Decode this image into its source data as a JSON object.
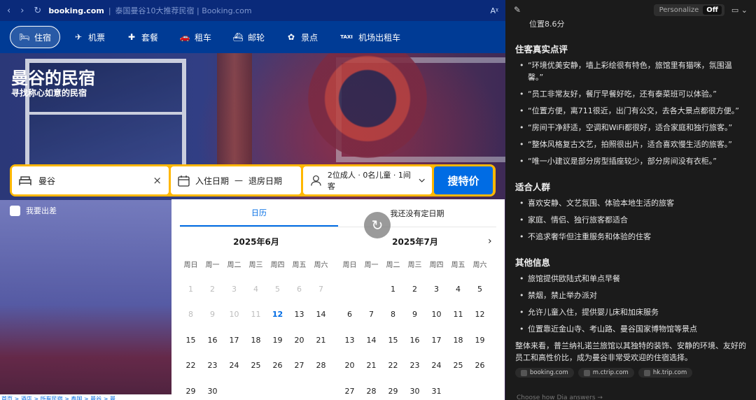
{
  "browser": {
    "domain": "booking.com",
    "separator": "|",
    "page_title": "泰国曼谷10大推荐民宿 | Booking.com",
    "nav_back": "‹",
    "nav_forward": "›",
    "reload": "↻",
    "translate": "Aᵡ"
  },
  "booking": {
    "tabs": [
      {
        "label": "住宿",
        "icon": "bed-icon",
        "glyph": "🛏"
      },
      {
        "label": "机票",
        "icon": "plane-icon",
        "glyph": "✈"
      },
      {
        "label": "套餐",
        "icon": "package-icon",
        "glyph": "✚"
      },
      {
        "label": "租车",
        "icon": "car-icon",
        "glyph": "🚗"
      },
      {
        "label": "邮轮",
        "icon": "ship-icon",
        "glyph": "⛴"
      },
      {
        "label": "景点",
        "icon": "attraction-icon",
        "glyph": "✿"
      },
      {
        "label": "机场出租车",
        "icon": "taxi-icon",
        "glyph": "TAXI"
      }
    ],
    "hero": {
      "title": "曼谷的民宿",
      "subtitle": "寻找称心如意的民宿"
    },
    "search": {
      "destination": "曼谷",
      "clear": "×",
      "checkin": "入住日期",
      "dash": "—",
      "checkout": "退房日期",
      "guests": "2位成人 · 0名儿童 · 1间客",
      "button": "搜特价"
    },
    "business_trip": "我要出差",
    "calendar": {
      "tab_calendar": "日历",
      "tab_flexible": "我还没有定日期",
      "weekdays": [
        "周日",
        "周一",
        "周二",
        "周三",
        "周四",
        "周五",
        "周六"
      ],
      "months": [
        {
          "title": "2025年6月",
          "leading_blanks": 0,
          "days": [
            "1",
            "2",
            "3",
            "4",
            "5",
            "6",
            "7",
            "8",
            "9",
            "10",
            "11",
            "12",
            "13",
            "14",
            "15",
            "16",
            "17",
            "18",
            "19",
            "20",
            "21",
            "22",
            "23",
            "24",
            "25",
            "26",
            "27",
            "28",
            "29",
            "30"
          ],
          "past_until": 11,
          "today": 12
        },
        {
          "title": "2025年7月",
          "leading_blanks": 2,
          "days": [
            "1",
            "2",
            "3",
            "4",
            "5",
            "6",
            "7",
            "8",
            "9",
            "10",
            "11",
            "12",
            "13",
            "14",
            "15",
            "16",
            "17",
            "18",
            "19",
            "20",
            "21",
            "22",
            "23",
            "24",
            "25",
            "26",
            "27",
            "28",
            "29",
            "30",
            "31"
          ],
          "past_until": 0,
          "today": 0
        }
      ]
    },
    "breadcrumb": "首页 > 酒店 > 所有民宿 > 泰国 > 曼谷 > 曼"
  },
  "panel": {
    "personalize": "Personalize",
    "toggle": "Off",
    "continuation": "位置8.6分",
    "sections": [
      {
        "heading": "住客真实点评",
        "items": [
          "“环境优美安静，墙上彩绘很有特色，旅馆里有猫咪，氛围温馨。”",
          "“员工非常友好，餐厅早餐好吃，还有泰菜班可以体验。”",
          "“位置方便，离711很近，出门有公交，去各大景点都很方便。”",
          "“房间干净舒适，空调和WiFi都很好，适合家庭和独行旅客。”",
          "“整体风格复古文艺，拍照很出片，适合喜欢慢生活的旅客。”",
          "“唯一小建议是部分房型插座较少，部分房间没有衣柜。”"
        ]
      },
      {
        "heading": "适合人群",
        "items": [
          "喜欢安静、文艺氛围、体验本地生活的旅客",
          "家庭、情侣、独行旅客都适合",
          "不追求奢华但注重服务和体验的住客"
        ]
      },
      {
        "heading": "其他信息",
        "items": [
          "旅馆提供欧陆式和单点早餐",
          "禁烟，禁止举办派对",
          "允许儿童入住，提供婴儿床和加床服务",
          "位置靠近金山寺、考山路、曼谷国家博物馆等景点"
        ]
      }
    ],
    "summary": "整体来看，普兰纳礼诺兰旅馆以其独特的装饰、安静的环境、友好的员工和高性价比，成为曼谷非常受欢迎的住宿选择。",
    "sources": [
      "booking.com",
      "m.ctrip.com",
      "hk.trip.com"
    ],
    "footer": "Choose how Dia answers →"
  }
}
